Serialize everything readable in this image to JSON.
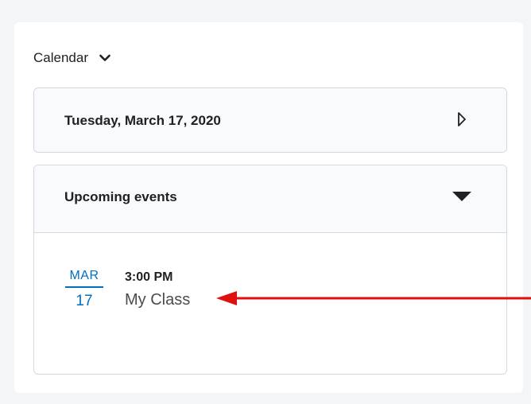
{
  "widget": {
    "title": "Calendar",
    "date_label": "Tuesday, March 17, 2020",
    "upcoming_title": "Upcoming events"
  },
  "event": {
    "month": "MAR",
    "day": "17",
    "time": "3:00 PM",
    "name": "My Class"
  },
  "colors": {
    "accent": "#006fbf",
    "annotation": "#e01010",
    "card_border": "#d3d9e3",
    "card_header_bg": "#f9fafb"
  },
  "icons": {
    "widget_menu": "chevron-down-icon",
    "next_day": "triangle-right-outline-icon",
    "collapse": "caret-down-icon"
  }
}
